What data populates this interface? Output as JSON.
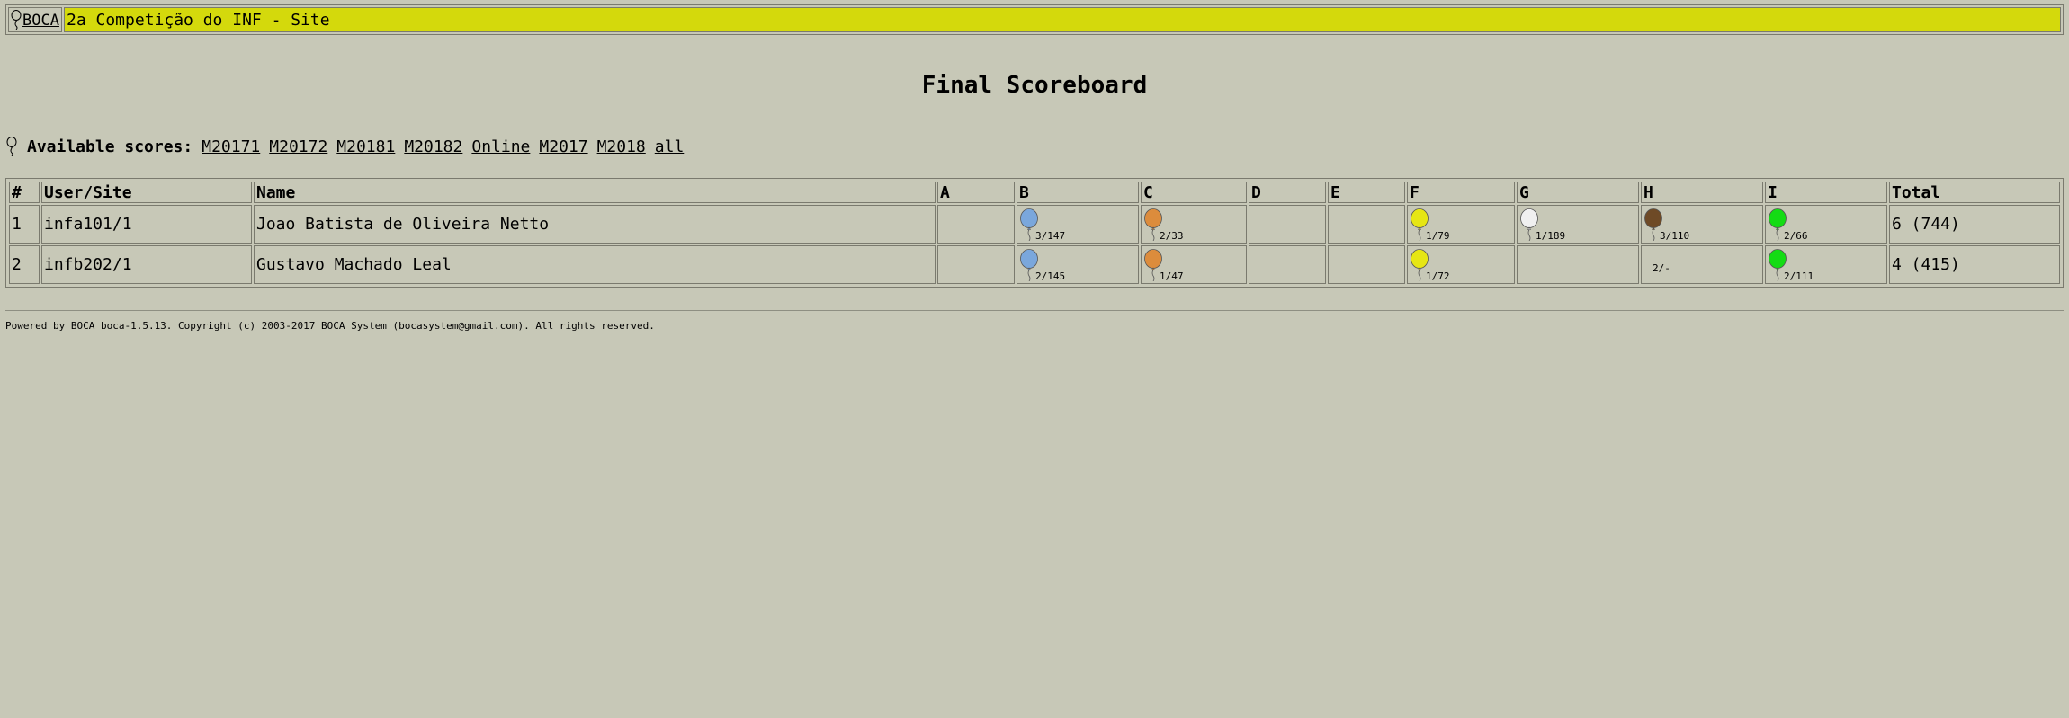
{
  "header": {
    "logo_text": "BOCA",
    "contest_title": "2a Competição do INF - Site",
    "bar_color": "#d4d90c"
  },
  "page_title": "Final Scoreboard",
  "scores_nav": {
    "label": "Available scores:",
    "links": [
      "M20171",
      "M20172",
      "M20181",
      "M20182",
      "Online",
      "M2017",
      "M2018",
      "all"
    ]
  },
  "table": {
    "headers": [
      "#",
      "User/Site",
      "Name",
      "A",
      "B",
      "C",
      "D",
      "E",
      "F",
      "G",
      "H",
      "I",
      "Total"
    ],
    "rows": [
      {
        "rank": "1",
        "user": "infa101/1",
        "name": "Joao Batista de Oliveira Netto",
        "problems": {
          "A": null,
          "B": {
            "score": "3/147",
            "balloon": "#7aa7dc"
          },
          "C": {
            "score": "2/33",
            "balloon": "#dc8c3c"
          },
          "D": null,
          "E": null,
          "F": {
            "score": "1/79",
            "balloon": "#e6e614"
          },
          "G": {
            "score": "1/189",
            "balloon": "#f0f0f0"
          },
          "H": {
            "score": "3/110",
            "balloon": "#6e4a26"
          },
          "I": {
            "score": "2/66",
            "balloon": "#14dc14"
          }
        },
        "total": "6 (744)"
      },
      {
        "rank": "2",
        "user": "infb202/1",
        "name": "Gustavo Machado Leal",
        "problems": {
          "A": null,
          "B": {
            "score": "2/145",
            "balloon": "#7aa7dc"
          },
          "C": {
            "score": "1/47",
            "balloon": "#dc8c3c"
          },
          "D": null,
          "E": null,
          "F": {
            "score": "1/72",
            "balloon": "#e6e614"
          },
          "G": null,
          "H": {
            "score": "2/-",
            "balloon": null
          },
          "I": {
            "score": "2/111",
            "balloon": "#14dc14"
          }
        },
        "total": "4 (415)"
      }
    ]
  },
  "footer": {
    "text": "Powered by BOCA boca-1.5.13. Copyright (c) 2003-2017 BOCA System (bocasystem@gmail.com). All rights reserved."
  }
}
